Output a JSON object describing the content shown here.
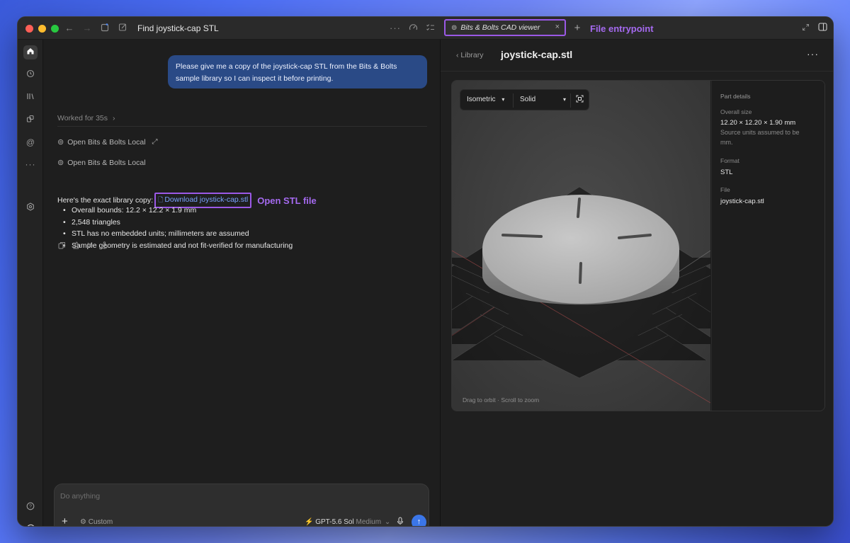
{
  "thread": {
    "title": "Find joystick-cap STL"
  },
  "tab": {
    "label": "Bits & Bolts CAD viewer",
    "close": "×"
  },
  "annotations": {
    "file_entrypoint": "File entrypoint",
    "open_stl": "Open STL file"
  },
  "chat": {
    "user_message": "Please give me a copy of the joystick-cap STL from the Bits & Bolts sample library so I can inspect it before printing.",
    "worked_for": "Worked for 35s",
    "tool_calls": [
      "Open Bits & Bolts Local",
      "Open Bits & Bolts Local"
    ],
    "answer_intro": "Here's the exact library copy:",
    "download_link": "Download joystick-cap.stl",
    "bullets": [
      "Overall bounds: 12.2 × 12.2 × 1.9 mm",
      "2,548 triangles",
      "STL has no embedded units; millimeters are assumed",
      "Sample geometry is estimated and not fit-verified for manufacturing"
    ]
  },
  "composer": {
    "placeholder": "Do anything",
    "custom": "Custom",
    "model": "GPT-5.6 Sol",
    "effort": "Medium"
  },
  "viewer": {
    "back_label": "Library",
    "file_title": "joystick-cap.stl",
    "view_mode": "Isometric",
    "render_mode": "Solid",
    "hint": "Drag to orbit · Scroll to zoom"
  },
  "details": {
    "heading": "Part details",
    "overall_size_label": "Overall size",
    "overall_size_value": "12.20 × 12.20 × 1.90 mm",
    "overall_size_note": "Source units assumed to be mm.",
    "format_label": "Format",
    "format_value": "STL",
    "file_label": "File",
    "file_value": "joystick-cap.stl"
  },
  "colors": {
    "accent": "#3b76e8",
    "annotation": "#a56af0",
    "user_bubble": "#2a4a86"
  }
}
